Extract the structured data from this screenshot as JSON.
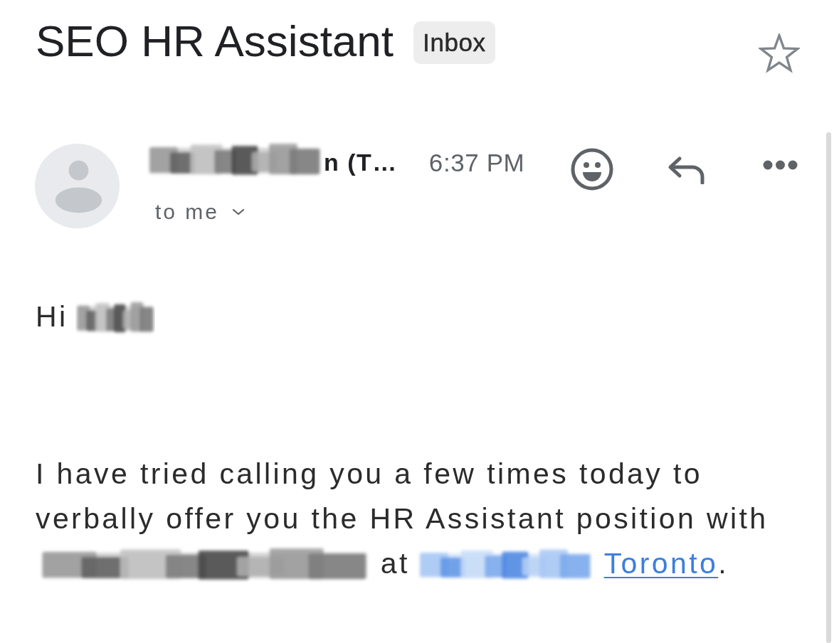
{
  "header": {
    "subject": "SEO HR Assistant",
    "label": "Inbox",
    "starred": false
  },
  "message": {
    "sender": {
      "name": "n (T…"
    },
    "time": "6:37 PM",
    "recipient": "to me"
  },
  "body": {
    "greeting": "Hi",
    "paragraph": [
      {
        "kind": "text",
        "text": "I have tried calling you a few times today to verbally offer you the HR Assistant position with"
      },
      {
        "kind": "redacted"
      },
      {
        "kind": "text",
        "text": "at"
      },
      {
        "kind": "redacted_link"
      },
      {
        "kind": "link",
        "text": "Toronto"
      },
      {
        "kind": "punct",
        "text": "."
      }
    ]
  }
}
